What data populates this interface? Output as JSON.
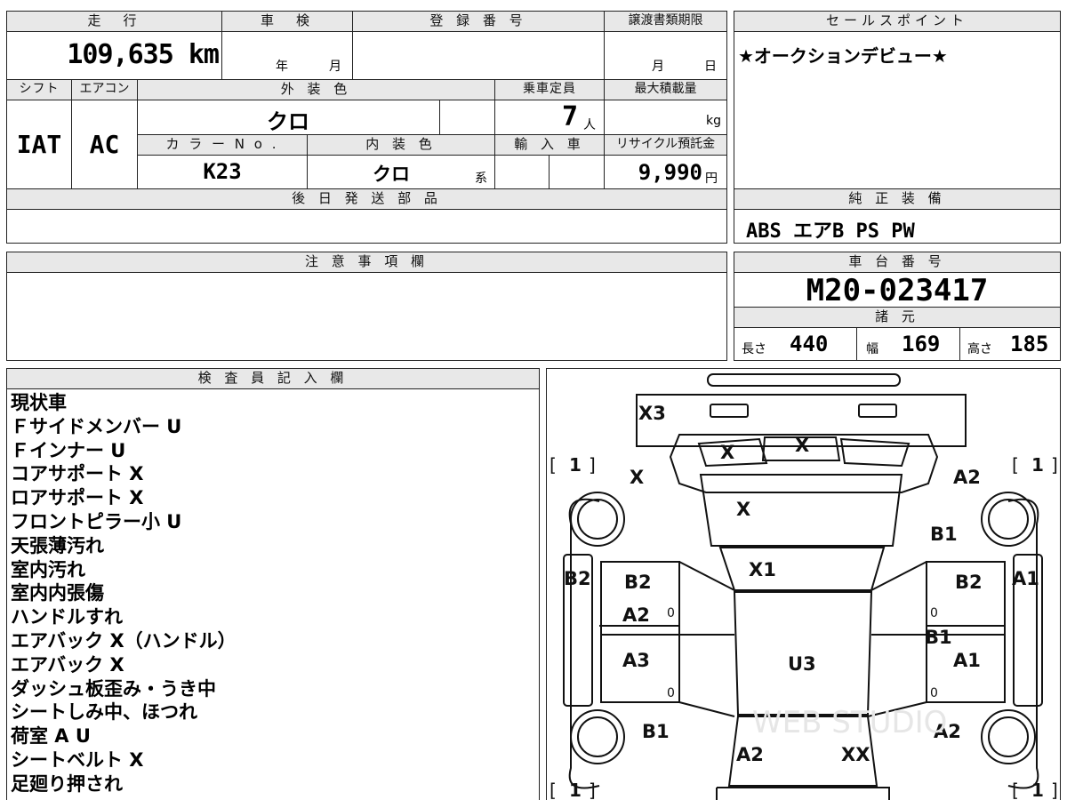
{
  "top": {
    "mileage_header": "走　行",
    "mileage_value": "109,635 km",
    "inspection_header": "車　検",
    "inspection_year_unit": "年",
    "inspection_month_unit": "月",
    "registration_header": "登 録 番 号",
    "transfer_deadline_header": "譲渡書類期限",
    "transfer_month_unit": "月",
    "transfer_day_unit": "日",
    "shift_header": "シフト",
    "shift_value": "IAT",
    "aircon_header": "エアコン",
    "aircon_value": "AC",
    "exterior_color_header": "外 装 色",
    "exterior_color_value": "クロ",
    "capacity_header": "乗車定員",
    "capacity_value": "7",
    "capacity_unit": "人",
    "max_load_header": "最大積載量",
    "max_load_unit": "kg",
    "color_no_header": "カ ラ ー N o .",
    "color_no_value": "K23",
    "interior_color_header": "内 装 色",
    "interior_color_value": "クロ",
    "interior_color_suffix": "系",
    "import_header": "輸 入 車",
    "recycle_header": "リサイクル預託金",
    "recycle_value": "9,990",
    "recycle_unit": "円",
    "later_parts_header": "後 日 発 送 部 品",
    "later_parts_value": ""
  },
  "sales_point": {
    "header": "セールスポイント",
    "text": "★オークションデビュー★"
  },
  "standard_equipment": {
    "header": "純 正 装 備",
    "value": "ABS エアB PS PW"
  },
  "notes": {
    "header": "注 意 事 項 欄",
    "text": ""
  },
  "chassis": {
    "header": "車 台 番 号",
    "value": "M20-023417"
  },
  "specs": {
    "header": "諸 元",
    "length_label": "長さ",
    "length_value": "440",
    "width_label": "幅",
    "width_value": "169",
    "height_label": "高さ",
    "height_value": "185"
  },
  "inspector": {
    "header": "検 査 員 記 入 欄",
    "lines": [
      "現状車",
      "Ｆサイドメンバー U",
      "Ｆインナー U",
      "コアサポート X",
      "ロアサポート X",
      "フロントピラー小 U",
      "天張薄汚れ",
      "室内汚れ",
      "室内内張傷",
      "ハンドルすれ",
      "エアバック X（ハンドル）",
      "エアバック X",
      "ダッシュ板歪み・うき中",
      "シートしみ中、ほつれ",
      "荷室 A U",
      "シートベルト X",
      "足廻り押され"
    ]
  },
  "diagram": {
    "marks": {
      "front_bumper": "X3",
      "grille_left": "X",
      "grille_right": "X",
      "fender_front_left": "X",
      "hood": "X",
      "windshield": "X1",
      "roof": "U3",
      "fender_front_right": "A2",
      "right_front_upper": "B1",
      "left_side": "B2",
      "left_front_door": "B2",
      "left_front_door_2": "A2",
      "left_rear_door": "A3",
      "left_rear_fender": "B1",
      "right_front_door": "B2",
      "right_middle": "B1",
      "right_rear_door": "A1",
      "right_side": "A1",
      "right_rear_fender": "A2",
      "rear_left": "A2",
      "rear_right": "XX",
      "glass_zero": "0"
    },
    "tire_label": "1",
    "watermark": "WEB STUDIO"
  }
}
